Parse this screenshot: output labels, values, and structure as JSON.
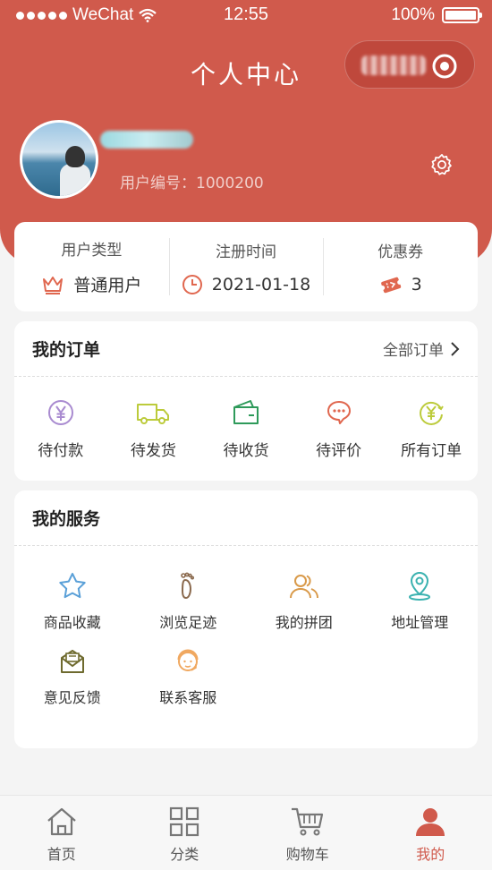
{
  "status_bar": {
    "carrier": "WeChat",
    "time": "12:55",
    "battery": "100%"
  },
  "header": {
    "title": "个人中心"
  },
  "user": {
    "id_label": "用户编号：1000200"
  },
  "info": [
    {
      "label": "用户类型",
      "value": "普通用户",
      "icon": "crown-icon"
    },
    {
      "label": "注册时间",
      "value": "2021-01-18",
      "icon": "clock-icon"
    },
    {
      "label": "优惠券",
      "value": "3",
      "icon": "coupon-icon"
    }
  ],
  "orders": {
    "title": "我的订单",
    "all_link": "全部订单",
    "items": [
      {
        "label": "待付款",
        "icon": "yen-circle-icon"
      },
      {
        "label": "待发货",
        "icon": "truck-icon"
      },
      {
        "label": "待收货",
        "icon": "wallet-icon"
      },
      {
        "label": "待评价",
        "icon": "chat-bubble-icon"
      },
      {
        "label": "所有订单",
        "icon": "refund-yen-icon"
      }
    ]
  },
  "services": {
    "title": "我的服务",
    "items": [
      {
        "label": "商品收藏",
        "icon": "star-icon"
      },
      {
        "label": "浏览足迹",
        "icon": "footprint-icon"
      },
      {
        "label": "我的拼团",
        "icon": "group-icon"
      },
      {
        "label": "地址管理",
        "icon": "location-pin-icon"
      },
      {
        "label": "意见反馈",
        "icon": "envelope-icon"
      },
      {
        "label": "联系客服",
        "icon": "customer-service-icon"
      }
    ]
  },
  "tabbar": [
    {
      "label": "首页",
      "icon": "home-icon",
      "active": false
    },
    {
      "label": "分类",
      "icon": "category-grid-icon",
      "active": false
    },
    {
      "label": "购物车",
      "icon": "cart-icon",
      "active": false
    },
    {
      "label": "我的",
      "icon": "profile-icon",
      "active": true
    }
  ],
  "colors": {
    "brand": "#d05a4c",
    "background": "#f4f4f4",
    "card": "#ffffff"
  }
}
